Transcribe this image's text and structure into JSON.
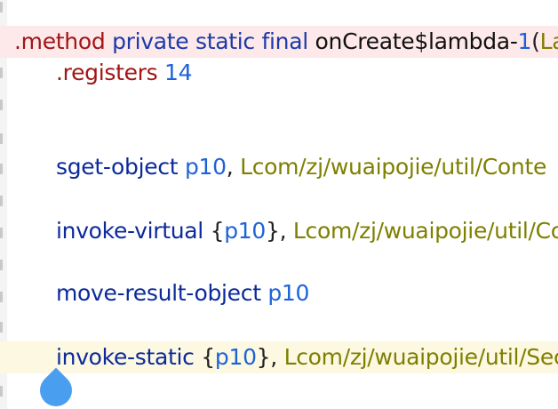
{
  "editor": {
    "lines": [
      {
        "directive": ".method",
        "modifiers": [
          "private",
          "static",
          "final"
        ],
        "name": "onCreate$lambda-",
        "name_number": "1",
        "paren": "(",
        "param_type": "La"
      },
      {
        "directive": ".registers",
        "value": "14"
      },
      {
        "op": "sget-object",
        "reg": "p10",
        "sep": ",",
        "type": "Lcom/zj/wuaipojie/util/Conte"
      },
      {
        "op": "invoke-virtual",
        "open": "{",
        "reg": "p10",
        "close": "},",
        "type": "Lcom/zj/wuaipojie/util/Co"
      },
      {
        "op": "move-result-object",
        "reg": "p10"
      },
      {
        "op": "invoke-static",
        "open": "{",
        "reg": "p10",
        "close": "},",
        "type": "Lcom/zj/wuaipojie/util/Sec"
      }
    ]
  },
  "colors": {
    "directive": "#a31515",
    "keyword": "#1c3aa9",
    "register": "#1d63d8",
    "type_ref": "#7f7f00",
    "current_line_highlight": "#fde8ea",
    "selected_line_highlight": "#fdf8e1",
    "cursor_handle": "#4a9ef0"
  },
  "icons": {
    "cursor_handle": "text-cursor-handle-icon"
  }
}
